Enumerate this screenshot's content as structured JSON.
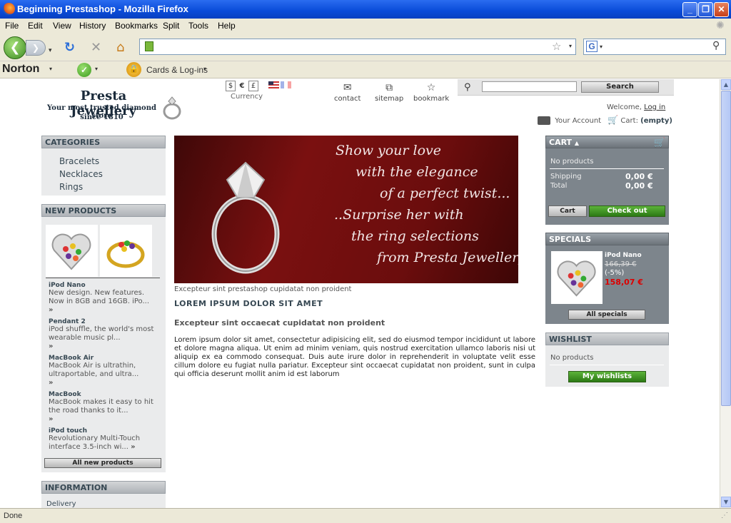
{
  "window": {
    "title": "Beginning Prestashop - Mozilla Firefox"
  },
  "menu": [
    "File",
    "Edit",
    "View",
    "History",
    "Bookmarks",
    "Split",
    "Tools",
    "Help"
  ],
  "nav": {
    "url": "",
    "search": ""
  },
  "norton": {
    "brand": "Norton",
    "cards": "Cards & Log-ins"
  },
  "site": {
    "logo_line1": "Presta Jewellery",
    "logo_line2": "Your most trusted diamond store",
    "logo_line3": "since 1810",
    "currency_label": "Currency",
    "currency_symbols": [
      "$",
      "€",
      "£"
    ],
    "links": {
      "contact": "contact",
      "sitemap": "sitemap",
      "bookmark": "bookmark"
    },
    "search_button": "Search",
    "welcome": "Welcome,",
    "login": "Log in",
    "account": "Your Account",
    "cart_label": "Cart:",
    "cart_state": "(empty)"
  },
  "categories": {
    "title": "CATEGORIES",
    "items": [
      "Bracelets",
      "Necklaces",
      "Rings"
    ]
  },
  "new_products": {
    "title": "NEW PRODUCTS",
    "items": [
      {
        "name": "iPod Nano",
        "desc": "New design. New features. Now in 8GB and 16GB. iPo..."
      },
      {
        "name": "Pendant 2",
        "desc": "iPod shuffle, the world's most wearable music pl..."
      },
      {
        "name": "MacBook Air",
        "desc": "MacBook Air is ultrathin, ultraportable, and ultra..."
      },
      {
        "name": "MacBook",
        "desc": "MacBook makes it easy to hit the road thanks to it..."
      },
      {
        "name": "iPod touch",
        "desc": "Revolutionary Multi-Touch interface 3.5-inch wi..."
      }
    ],
    "button": "All new products"
  },
  "information": {
    "title": "INFORMATION",
    "items": [
      "Delivery"
    ]
  },
  "banner": {
    "lines": [
      "Show your love",
      "with the elegance",
      "of a perfect twist...",
      "..Surprise her with",
      "the ring selections",
      "from Presta Jewellery"
    ]
  },
  "main": {
    "caption": "Excepteur sint prestashop cupidatat non proident",
    "heading": "LOREM IPSUM DOLOR SIT AMET",
    "subheading": "Excepteur sint occaecat cupidatat non proident",
    "body": "Lorem ipsum dolor sit amet, consectetur adipisicing elit, sed do eiusmod tempor incididunt ut labore et dolore magna aliqua. Ut enim ad minim veniam, quis nostrud exercitation ullamco laboris nisi ut aliquip ex ea commodo consequat. Duis aute irure dolor in reprehenderit in voluptate velit esse cillum dolore eu fugiat nulla pariatur. Excepteur sint occaecat cupidatat non proident, sunt in culpa qui officia deserunt mollit anim id est laborum"
  },
  "cart": {
    "title": "CART",
    "empty": "No products",
    "shipping_label": "Shipping",
    "shipping": "0,00 €",
    "total_label": "Total",
    "total": "0,00 €",
    "cart_button": "Cart",
    "checkout_button": "Check out"
  },
  "specials": {
    "title": "SPECIALS",
    "name": "iPod Nano",
    "old_price": "166,39 €",
    "discount": "(-5%)",
    "price": "158,07 €",
    "button": "All specials"
  },
  "wishlist": {
    "title": "WISHLIST",
    "empty": "No products",
    "button": "My wishlists"
  },
  "status": {
    "text": "Done"
  }
}
